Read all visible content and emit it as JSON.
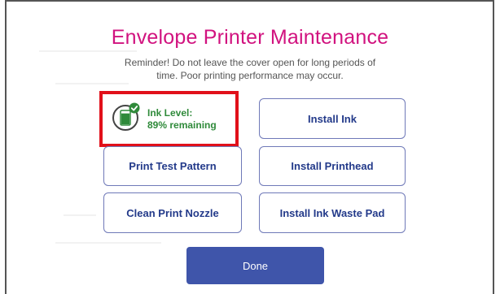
{
  "screen": {
    "title": "Envelope Printer Maintenance",
    "reminder_line1": "Reminder! Do not leave the cover open for long periods of",
    "reminder_line2": "time. Poor printing performance may occur."
  },
  "ink_status": {
    "label": "Ink Level:",
    "remaining": "89% remaining",
    "level_fraction": 0.89,
    "icon": "ink-cartridge-check-icon",
    "status_color": "#2f8a3a",
    "highlight_color": "#e1101a"
  },
  "buttons": {
    "install_ink": "Install Ink",
    "print_test_pattern": "Print Test Pattern",
    "install_printhead": "Install Printhead",
    "clean_print_nozzle": "Clean Print Nozzle",
    "install_ink_waste_pad": "Install Ink Waste Pad",
    "done": "Done"
  },
  "colors": {
    "title": "#d1127f",
    "button_text": "#233a8a",
    "button_border": "#6f79b8",
    "primary_button": "#3f55aa"
  }
}
